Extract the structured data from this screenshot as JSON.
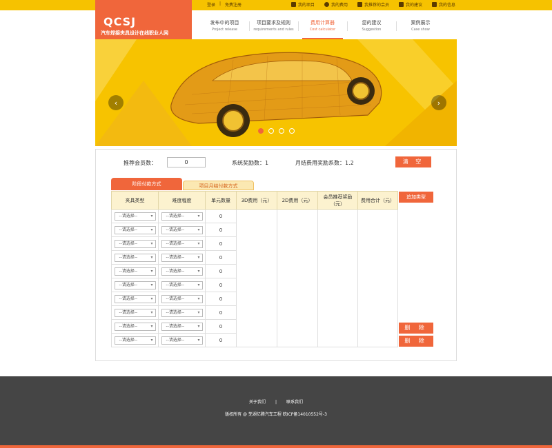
{
  "topbar": {
    "login": "登录",
    "separator": "|",
    "register": "免费注册",
    "user_links": [
      {
        "label": "我的项目",
        "icon": "document-icon"
      },
      {
        "label": "我的费用",
        "icon": "coin-icon"
      },
      {
        "label": "我推荐的会员",
        "icon": "member-card-icon"
      },
      {
        "label": "我的建议",
        "icon": "edit-icon"
      },
      {
        "label": "我的信息",
        "icon": "mail-icon"
      }
    ]
  },
  "logo": {
    "brand": "QCSJ",
    "tagline": "汽车焊接夹具设计在线职业人网"
  },
  "nav": [
    {
      "zh": "发布中的项目",
      "en": "Project release"
    },
    {
      "zh": "项目要求及规则",
      "en": "requirements and rules"
    },
    {
      "zh": "费用计算器",
      "en": "Cost calculator"
    },
    {
      "zh": "您的建议",
      "en": "Suggestion"
    },
    {
      "zh": "案例展示",
      "en": "Case show"
    }
  ],
  "banner": {
    "prev": "‹",
    "next": "›",
    "slides": 4,
    "active_slide": 1
  },
  "calculator": {
    "referral_label": "推荐会员数：",
    "referral_value": "0",
    "system_reward": "系统奖励数：1",
    "monthly_coefficient": "月结费用奖励系数：1.2",
    "clear_button": "清 空",
    "tabs": [
      "阶段付款方式",
      "项目月结付款方式"
    ],
    "columns": [
      "夹具类型",
      "难度程度",
      "单元数量",
      "3D费用（元）",
      "2D费用（元）",
      "会员推荐奖励（元）",
      "费用合计（元）"
    ],
    "select_placeholder": "--请选择--",
    "rows": [
      "0",
      "0",
      "0",
      "0",
      "0",
      "0",
      "0",
      "0",
      "0",
      "0"
    ],
    "add_type_button": "追加类型",
    "delete_button": "删 除"
  },
  "footer": {
    "about": "关于我们",
    "separator": "|",
    "contact": "联系我们",
    "copyright": "版权所有 @ 芜湖亿腾汽车工程 皖ICP备14010552号-3"
  },
  "colors": {
    "accent": "#f0663b",
    "topbar": "#f6c200",
    "banner": "#f7c300",
    "footer": "#454545",
    "table_header": "#fcf2cf"
  }
}
